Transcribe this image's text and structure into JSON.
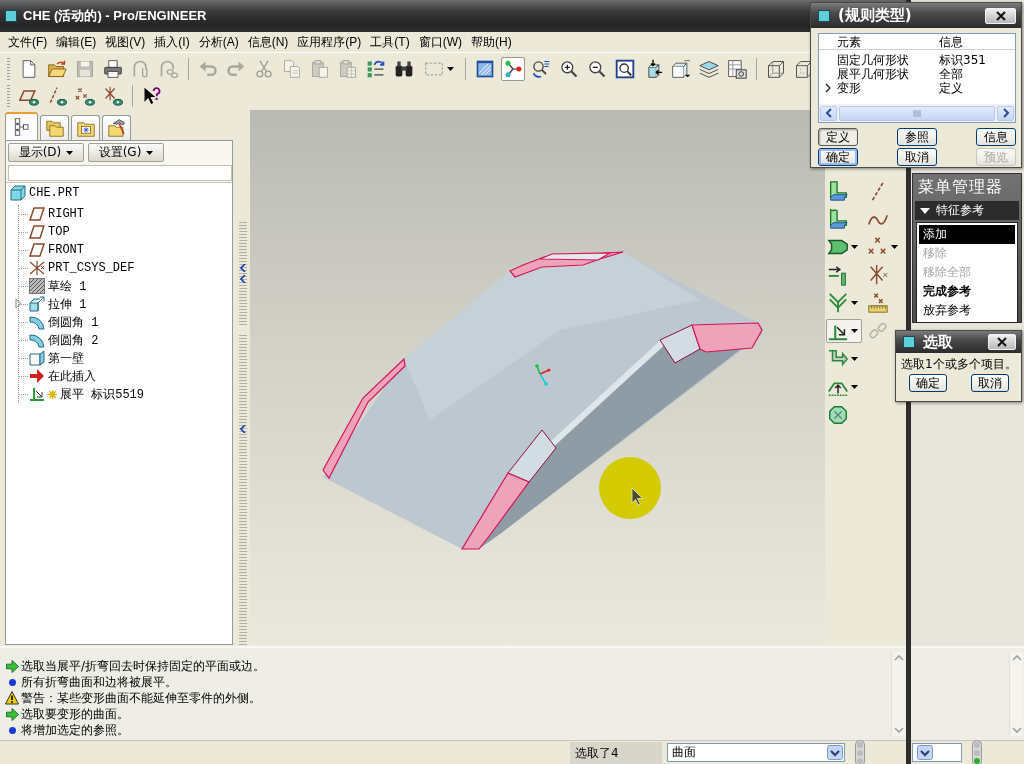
{
  "window": {
    "title": "CHE (活动的) - Pro/ENGINEER"
  },
  "menu_bar": [
    "文件(F)",
    "编辑(E)",
    "视图(V)",
    "插入(I)",
    "分析(A)",
    "信息(N)",
    "应用程序(P)",
    "工具(T)",
    "窗口(W)",
    "帮助(H)"
  ],
  "toolbar": {
    "row_1": [
      {
        "disabled": false,
        "selected": false
      },
      {
        "disabled": false,
        "selected": false
      },
      {
        "disabled": true,
        "selected": false
      },
      {
        "disabled": false,
        "selected": false
      },
      {
        "disabled": true,
        "selected": false
      },
      {
        "disabled": true,
        "selected": false
      },
      {
        "disabled": true,
        "selected": false
      },
      {
        "disabled": true,
        "selected": false
      },
      {
        "disabled": true,
        "selected": false
      },
      {
        "disabled": true,
        "selected": false
      },
      {
        "disabled": true,
        "selected": false
      },
      {
        "disabled": true,
        "selected": false
      },
      {
        "disabled": false,
        "selected": false
      },
      {
        "disabled": false,
        "selected": false
      },
      {
        "disabled": true,
        "selected": false
      },
      {
        "disabled": false,
        "selected": false
      },
      {
        "disabled": false,
        "selected": true
      },
      {
        "disabled": false,
        "selected": false
      },
      {
        "disabled": false,
        "selected": false
      },
      {
        "disabled": false,
        "selected": false
      },
      {
        "disabled": false,
        "selected": false
      },
      {
        "disabled": false,
        "selected": false
      },
      {
        "disabled": false,
        "selected": false
      },
      {
        "disabled": false,
        "selected": false
      },
      {
        "disabled": false,
        "selected": false
      },
      {
        "disabled": false,
        "selected": false
      },
      {
        "disabled": false,
        "selected": false
      }
    ],
    "row_2": [
      {
        "disabled": false,
        "selected": false
      },
      {
        "disabled": false,
        "selected": false
      },
      {
        "disabled": false,
        "selected": false
      },
      {
        "disabled": false,
        "selected": false
      },
      {
        "disabled": false,
        "selected": false
      }
    ]
  },
  "model_tree": {
    "tabs": [
      {
        "selected": true
      },
      {
        "selected": false
      },
      {
        "selected": false
      },
      {
        "selected": false
      }
    ],
    "buttons": [
      "显示(D)",
      "设置(G)"
    ],
    "root": {
      "label": "CHE.PRT",
      "kind": "part",
      "children": [
        {
          "label": "RIGHT",
          "kind": "datum_plane",
          "new": false
        },
        {
          "label": "TOP",
          "kind": "datum_plane",
          "new": false
        },
        {
          "label": "FRONT",
          "kind": "datum_plane",
          "new": false
        },
        {
          "label": "PRT_CSYS_DEF",
          "kind": "csys",
          "new": false
        },
        {
          "label": "草绘 1",
          "kind": "sketch",
          "new": false
        },
        {
          "label": "拉伸 1",
          "kind": "extrude",
          "new": false,
          "expanded": false
        },
        {
          "label": "倒圆角 1",
          "kind": "round",
          "new": false
        },
        {
          "label": "倒圆角 2",
          "kind": "round",
          "new": false
        },
        {
          "label": "第一壁",
          "kind": "wall",
          "new": false
        },
        {
          "label": "在此插入",
          "kind": "insert_here",
          "new": false
        },
        {
          "label": "展平 标识5519",
          "kind": "unbend",
          "new": true
        }
      ]
    }
  },
  "feature_toolbar": {
    "column_1": [
      {
        "disabled": false,
        "selected": false
      },
      {
        "disabled": false,
        "selected": false
      },
      {
        "disabled": false,
        "selected": false
      },
      {
        "disabled": false,
        "selected": false
      },
      {
        "disabled": false,
        "selected": false
      },
      {
        "disabled": false,
        "selected": true
      },
      {
        "disabled": false,
        "selected": false
      },
      {
        "disabled": false,
        "selected": false
      },
      {
        "disabled": false,
        "selected": false
      }
    ],
    "column_2": [
      {
        "disabled": false,
        "selected": false
      },
      {
        "disabled": false,
        "selected": false
      },
      {
        "disabled": false,
        "selected": false
      },
      {
        "disabled": false,
        "selected": false
      },
      {
        "disabled": false,
        "selected": false
      },
      {
        "disabled": true,
        "selected": false
      }
    ]
  },
  "rule_dialog": {
    "title": "(规则类型)",
    "columns": [
      "元素",
      "信息"
    ],
    "rows": [
      {
        "element": "固定几何形状",
        "info": "标识351",
        "current": false
      },
      {
        "element": "展平几何形状",
        "info": "全部",
        "current": false
      },
      {
        "element": "变形",
        "info": "定义",
        "current": true
      }
    ],
    "buttons": [
      {
        "label": "定义",
        "selected": true,
        "default": false,
        "disabled": false
      },
      {
        "label": "参照",
        "selected": false,
        "default": false,
        "disabled": false
      },
      {
        "label": "信息",
        "selected": false,
        "default": false,
        "disabled": false
      },
      {
        "label": "确定",
        "selected": false,
        "default": true,
        "disabled": false
      },
      {
        "label": "取消",
        "selected": false,
        "default": false,
        "disabled": false
      },
      {
        "label": "预览",
        "selected": false,
        "default": false,
        "disabled": true
      }
    ]
  },
  "menu_manager": {
    "title": "菜单管理器",
    "section": "特征参考",
    "items": [
      {
        "label": "添加",
        "selected": true,
        "disabled": false,
        "default": false
      },
      {
        "label": "移除",
        "selected": false,
        "disabled": true,
        "default": false
      },
      {
        "label": "移除全部",
        "selected": false,
        "disabled": true,
        "default": false
      },
      {
        "label": "完成参考",
        "selected": false,
        "disabled": false,
        "default": true
      },
      {
        "label": "放弃参考",
        "selected": false,
        "disabled": false,
        "default": false
      }
    ]
  },
  "select_dialog": {
    "title": "选取",
    "prompt": "选取1个或多个项目。",
    "buttons": [
      "确定",
      "取消"
    ]
  },
  "messages": [
    {
      "kind": "prompt",
      "text": "选取当展平/折弯回去时保持固定的平面或边。"
    },
    {
      "kind": "info",
      "text": "所有折弯曲面和边将被展平。"
    },
    {
      "kind": "warning",
      "text": "警告：某些变形曲面不能延伸至零件的外侧。"
    },
    {
      "kind": "prompt",
      "text": "选取要变形的曲面。"
    },
    {
      "kind": "info",
      "text": "将增加选定的参照。"
    }
  ],
  "status_bar": {
    "selection": "选取了4",
    "filter": "曲面"
  }
}
